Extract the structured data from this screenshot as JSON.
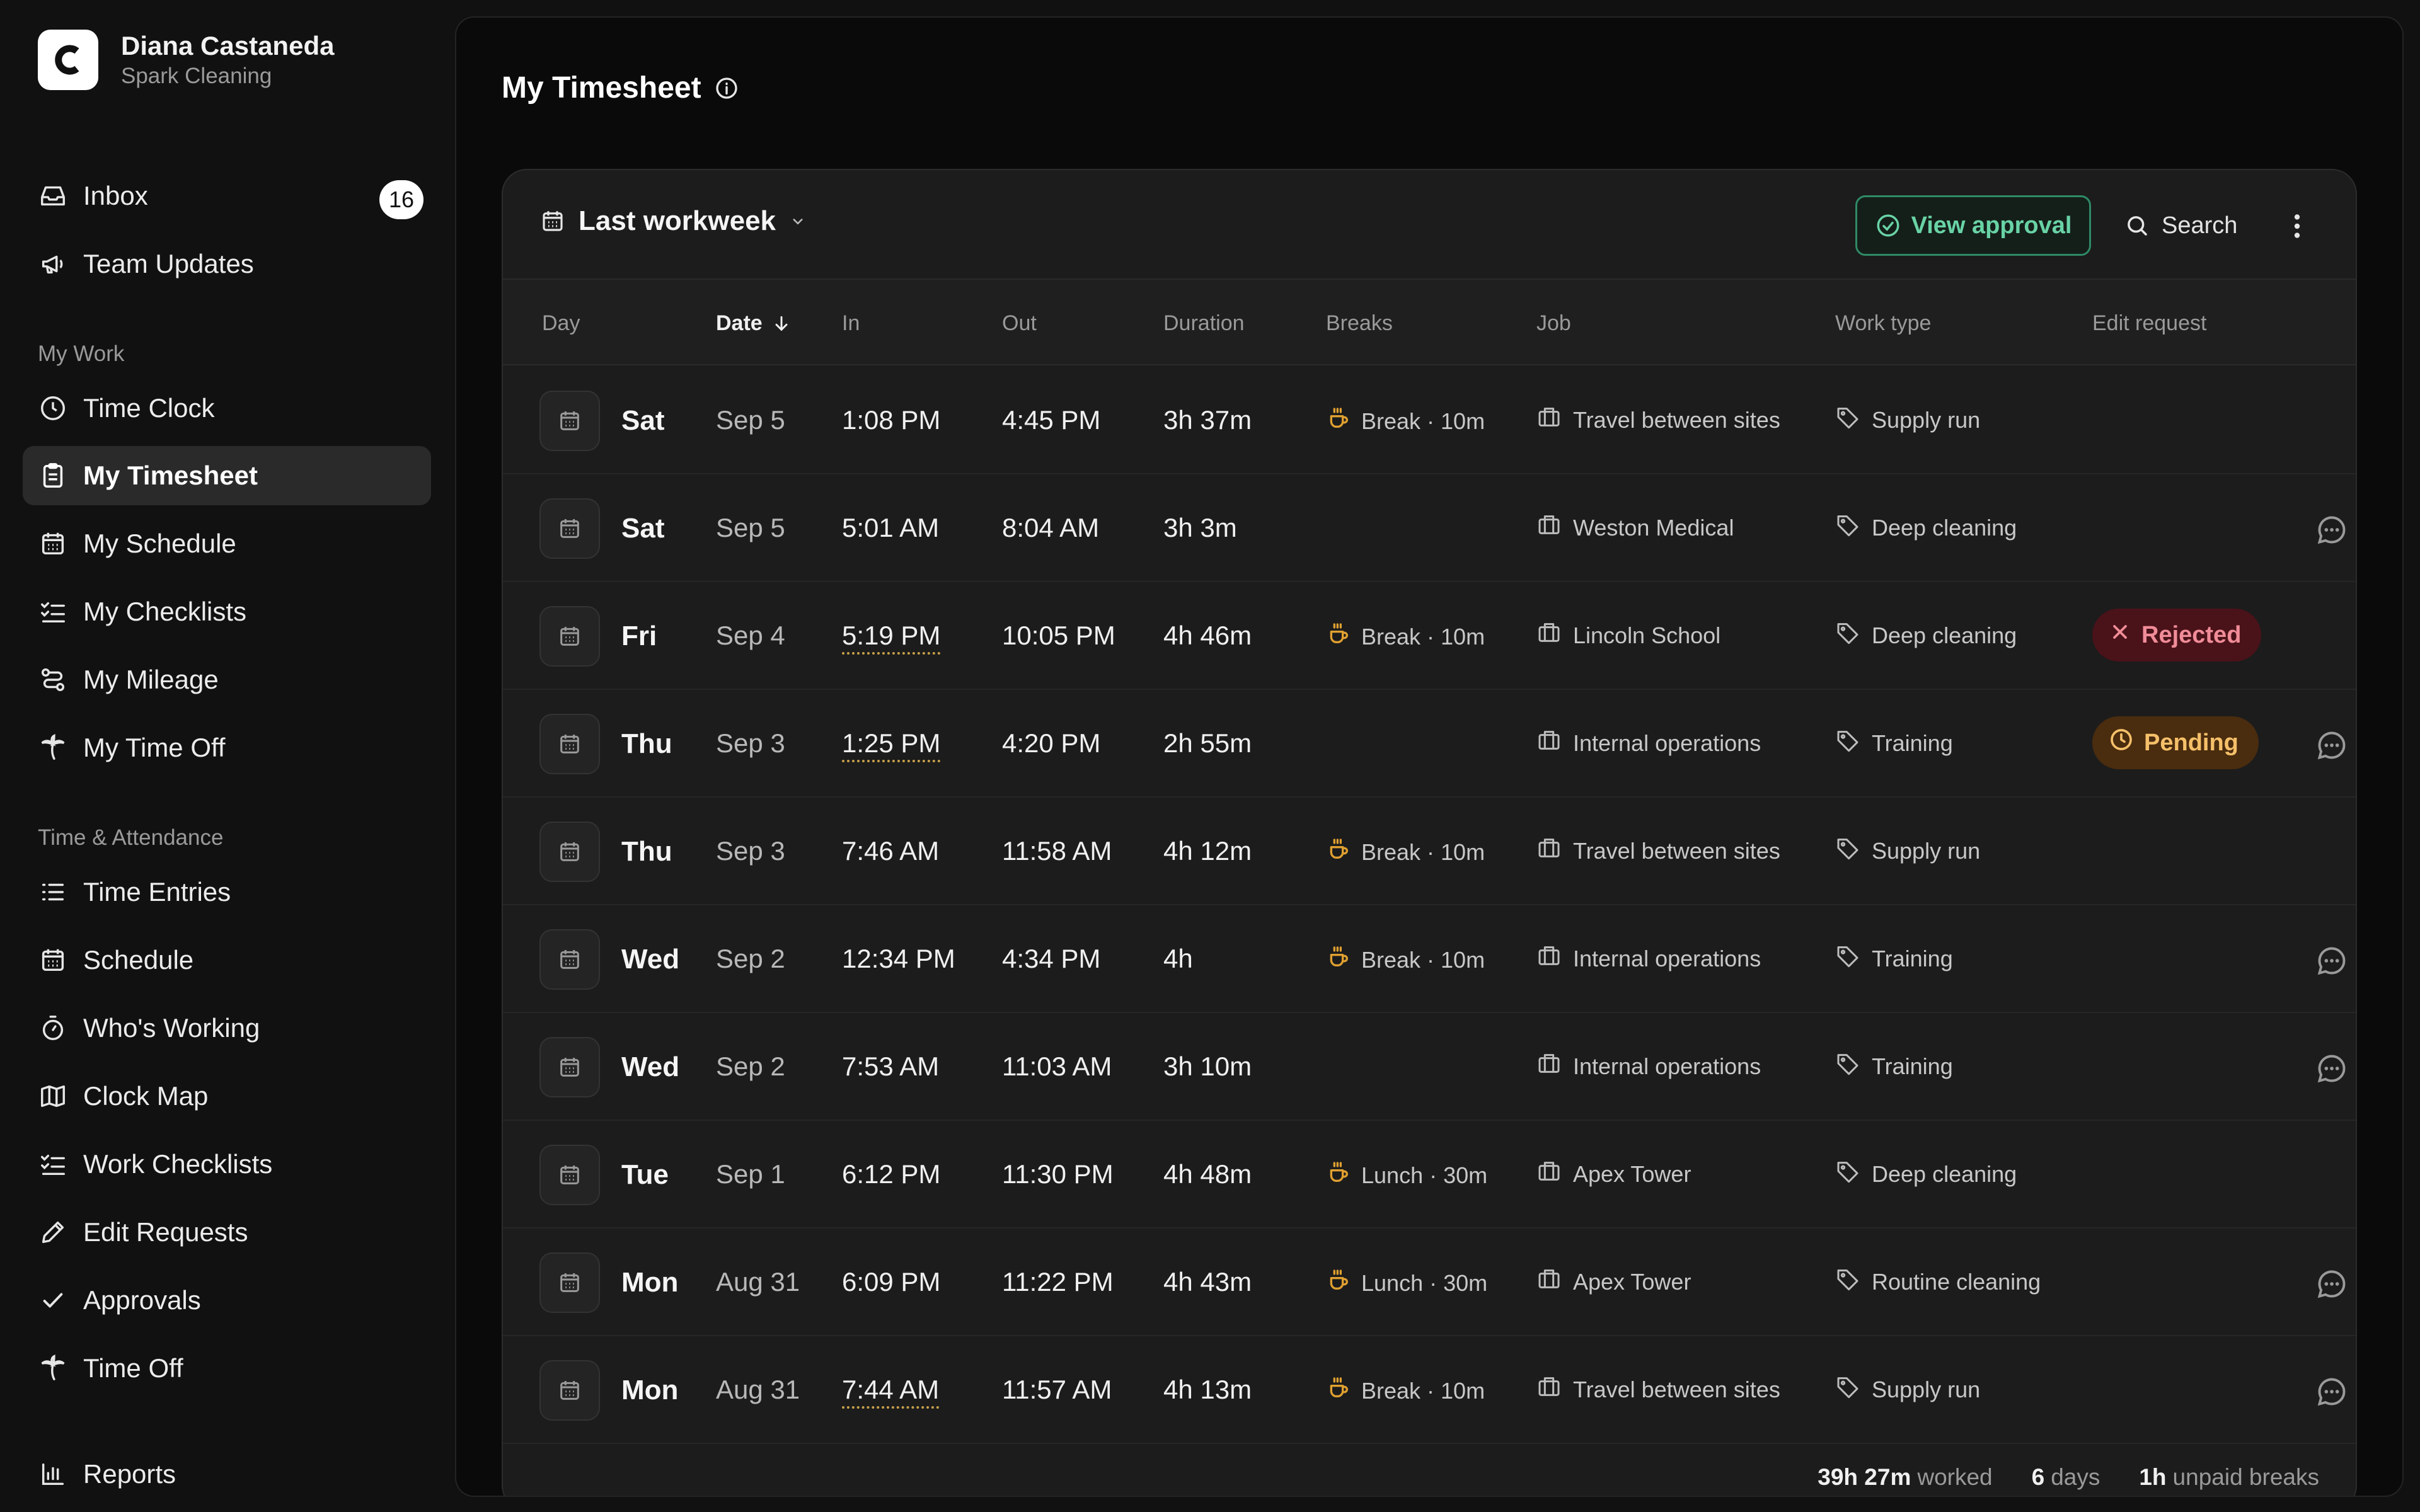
{
  "user": {
    "name": "Diana Castaneda",
    "company": "Spark Cleaning",
    "logo_letter": "C"
  },
  "sidebar": {
    "top_items": [
      {
        "label": "Inbox",
        "icon": "inbox-icon",
        "badge": "16"
      },
      {
        "label": "Team Updates",
        "icon": "megaphone-icon"
      }
    ],
    "my_work_title": "My Work",
    "my_work": [
      {
        "label": "Time Clock",
        "icon": "clock-icon"
      },
      {
        "label": "My Timesheet",
        "icon": "clipboard-icon",
        "active": true
      },
      {
        "label": "My Schedule",
        "icon": "calendar-icon"
      },
      {
        "label": "My Checklists",
        "icon": "checklist-icon"
      },
      {
        "label": "My Mileage",
        "icon": "route-icon"
      },
      {
        "label": "My Time Off",
        "icon": "palm-tree-icon"
      }
    ],
    "ta_title": "Time & Attendance",
    "ta": [
      {
        "label": "Time Entries",
        "icon": "list-icon"
      },
      {
        "label": "Schedule",
        "icon": "calendar-icon"
      },
      {
        "label": "Who's Working",
        "icon": "stopwatch-icon"
      },
      {
        "label": "Clock Map",
        "icon": "map-icon"
      },
      {
        "label": "Work Checklists",
        "icon": "checklist-icon"
      },
      {
        "label": "Edit Requests",
        "icon": "pencil-icon"
      },
      {
        "label": "Approvals",
        "icon": "check-icon"
      },
      {
        "label": "Time Off",
        "icon": "palm-tree-icon"
      }
    ],
    "bottom": {
      "label": "Reports",
      "icon": "bar-chart-icon"
    }
  },
  "page": {
    "title": "My Timesheet"
  },
  "toolbar": {
    "period": "Last workweek",
    "view_approval": "View approval",
    "search": "Search"
  },
  "table": {
    "headers": {
      "day": "Day",
      "date": "Date",
      "in": "In",
      "out": "Out",
      "duration": "Duration",
      "breaks": "Breaks",
      "job": "Job",
      "work_type": "Work type",
      "edit_request": "Edit request"
    },
    "rows": [
      {
        "day": "Sat",
        "date": "Sep 5",
        "in": "1:08 PM",
        "out": "4:45 PM",
        "duration": "3h 37m",
        "break": "Break · 10m",
        "job": "Travel between sites",
        "work_type": "Supply run",
        "edited": false,
        "status": "",
        "comment": false
      },
      {
        "day": "Sat",
        "date": "Sep 5",
        "in": "5:01 AM",
        "out": "8:04 AM",
        "duration": "3h 3m",
        "break": "",
        "job": "Weston Medical",
        "work_type": "Deep cleaning",
        "edited": false,
        "status": "",
        "comment": true
      },
      {
        "day": "Fri",
        "date": "Sep 4",
        "in": "5:19 PM",
        "out": "10:05 PM",
        "duration": "4h 46m",
        "break": "Break · 10m",
        "job": "Lincoln School",
        "work_type": "Deep cleaning",
        "edited": true,
        "status": "Rejected",
        "comment": false
      },
      {
        "day": "Thu",
        "date": "Sep 3",
        "in": "1:25 PM",
        "out": "4:20 PM",
        "duration": "2h 55m",
        "break": "",
        "job": "Internal operations",
        "work_type": "Training",
        "edited": true,
        "status": "Pending",
        "comment": true
      },
      {
        "day": "Thu",
        "date": "Sep 3",
        "in": "7:46 AM",
        "out": "11:58 AM",
        "duration": "4h 12m",
        "break": "Break · 10m",
        "job": "Travel between sites",
        "work_type": "Supply run",
        "edited": false,
        "status": "",
        "comment": false
      },
      {
        "day": "Wed",
        "date": "Sep 2",
        "in": "12:34 PM",
        "out": "4:34 PM",
        "duration": "4h",
        "break": "Break · 10m",
        "job": "Internal operations",
        "work_type": "Training",
        "edited": false,
        "status": "",
        "comment": true
      },
      {
        "day": "Wed",
        "date": "Sep 2",
        "in": "7:53 AM",
        "out": "11:03 AM",
        "duration": "3h 10m",
        "break": "",
        "job": "Internal operations",
        "work_type": "Training",
        "edited": false,
        "status": "",
        "comment": true
      },
      {
        "day": "Tue",
        "date": "Sep 1",
        "in": "6:12 PM",
        "out": "11:30 PM",
        "duration": "4h 48m",
        "break": "Lunch · 30m",
        "job": "Apex Tower",
        "work_type": "Deep cleaning",
        "edited": false,
        "status": "",
        "comment": false
      },
      {
        "day": "Mon",
        "date": "Aug 31",
        "in": "6:09 PM",
        "out": "11:22 PM",
        "duration": "4h 43m",
        "break": "Lunch · 30m",
        "job": "Apex Tower",
        "work_type": "Routine cleaning",
        "edited": false,
        "status": "",
        "comment": true
      },
      {
        "day": "Mon",
        "date": "Aug 31",
        "in": "7:44 AM",
        "out": "11:57 AM",
        "duration": "4h 13m",
        "break": "Break · 10m",
        "job": "Travel between sites",
        "work_type": "Supply run",
        "edited": true,
        "status": "",
        "comment": true
      }
    ]
  },
  "summary": {
    "worked_value": "39h 27m",
    "worked_label": "worked",
    "days_value": "6",
    "days_label": "days",
    "breaks_value": "1h",
    "breaks_label": "unpaid breaks"
  },
  "colors": {
    "accent_green": "#69d3a6",
    "break_icon": "#e0a030",
    "rejected": "#f08c98",
    "pending": "#f5c06a"
  }
}
